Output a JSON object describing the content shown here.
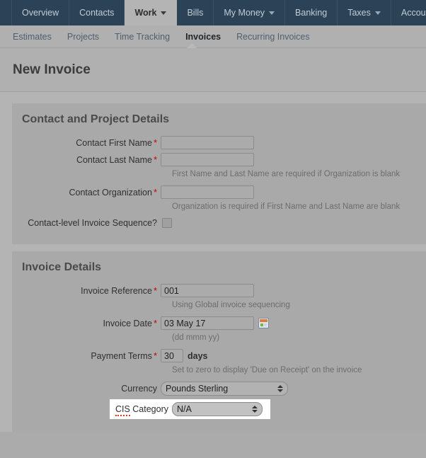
{
  "topnav": {
    "items": [
      {
        "label": "Overview",
        "has_caret": false,
        "active": false
      },
      {
        "label": "Contacts",
        "has_caret": false,
        "active": false
      },
      {
        "label": "Work",
        "has_caret": true,
        "active": true
      },
      {
        "label": "Bills",
        "has_caret": false,
        "active": false
      },
      {
        "label": "My Money",
        "has_caret": true,
        "active": false
      },
      {
        "label": "Banking",
        "has_caret": false,
        "active": false
      },
      {
        "label": "Taxes",
        "has_caret": true,
        "active": false
      },
      {
        "label": "Accounting",
        "has_caret": true,
        "active": false
      }
    ]
  },
  "subnav": {
    "items": [
      {
        "label": "Estimates",
        "active": false
      },
      {
        "label": "Projects",
        "active": false
      },
      {
        "label": "Time Tracking",
        "active": false
      },
      {
        "label": "Invoices",
        "active": true
      },
      {
        "label": "Recurring Invoices",
        "active": false
      }
    ]
  },
  "page": {
    "title": "New Invoice"
  },
  "contact_panel": {
    "title": "Contact and Project Details",
    "first_name": {
      "label": "Contact First Name",
      "required": "*",
      "value": "",
      "placeholder": ""
    },
    "last_name": {
      "label": "Contact Last Name",
      "required": "*",
      "value": "",
      "placeholder": "",
      "hint": "First Name and Last Name are required if Organization is blank"
    },
    "organization": {
      "label": "Contact Organization",
      "required": "*",
      "value": "",
      "placeholder": "",
      "hint": "Organization is required if First Name and Last Name are blank"
    },
    "contact_sequence": {
      "label": "Contact-level Invoice Sequence?",
      "checked": false
    }
  },
  "invoice_panel": {
    "title": "Invoice Details",
    "reference": {
      "label": "Invoice Reference",
      "required": "*",
      "value": "001",
      "hint": "Using Global invoice sequencing"
    },
    "invoice_date": {
      "label": "Invoice Date",
      "required": "*",
      "value": "03 May 17",
      "hint": "(dd mmm yy)",
      "picker_icon": "calendar-icon"
    },
    "payment_terms": {
      "label": "Payment Terms",
      "required": "*",
      "value": "30",
      "unit": "days",
      "hint": "Set to zero to display 'Due on Receipt' on the invoice"
    },
    "currency": {
      "label": "Currency",
      "value": "Pounds Sterling",
      "options": [
        "Pounds Sterling"
      ]
    },
    "cis_category": {
      "label_prefix": "CIS",
      "label_suffix": " Category",
      "value": "N/A",
      "options": [
        "N/A"
      ]
    }
  },
  "colors": {
    "navbar": "#2b4257",
    "page_bg": "#b4b4b4",
    "panel_bg": "#a9a9a9",
    "required_marker": "#cc0000",
    "highlight_bg": "#ffffff"
  }
}
